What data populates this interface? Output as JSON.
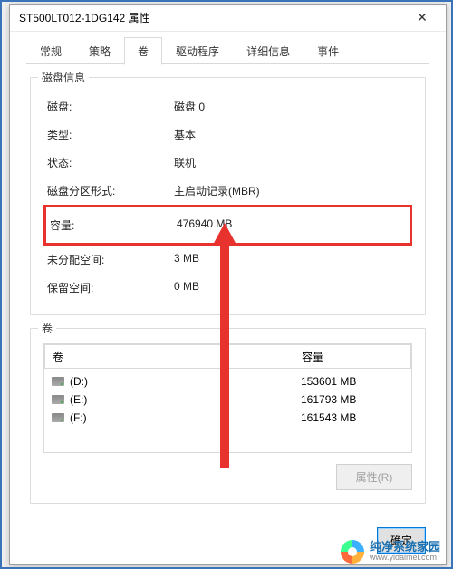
{
  "window": {
    "title": "ST500LT012-1DG142 属性"
  },
  "tabs": [
    {
      "label": "常规",
      "active": false
    },
    {
      "label": "策略",
      "active": false
    },
    {
      "label": "卷",
      "active": true
    },
    {
      "label": "驱动程序",
      "active": false
    },
    {
      "label": "详细信息",
      "active": false
    },
    {
      "label": "事件",
      "active": false
    }
  ],
  "disk_info": {
    "legend": "磁盘信息",
    "rows": [
      {
        "label": "磁盘:",
        "value": "磁盘 0"
      },
      {
        "label": "类型:",
        "value": "基本"
      },
      {
        "label": "状态:",
        "value": "联机"
      },
      {
        "label": "磁盘分区形式:",
        "value": "主启动记录(MBR)"
      },
      {
        "label": "容量:",
        "value": "476940 MB",
        "highlight": true
      },
      {
        "label": "未分配空间:",
        "value": "3 MB"
      },
      {
        "label": "保留空间:",
        "value": "0 MB"
      }
    ]
  },
  "volumes": {
    "legend": "卷",
    "headers": {
      "name": "卷",
      "size": "容量"
    },
    "items": [
      {
        "name": "(D:)",
        "size": "153601 MB"
      },
      {
        "name": "(E:)",
        "size": "161793 MB"
      },
      {
        "name": "(F:)",
        "size": "161543 MB"
      }
    ],
    "properties_btn": "属性(R)"
  },
  "buttons": {
    "ok": "确定"
  },
  "watermark": {
    "line1": "纯净系统家园",
    "line2": "www.yidaimei.com"
  }
}
